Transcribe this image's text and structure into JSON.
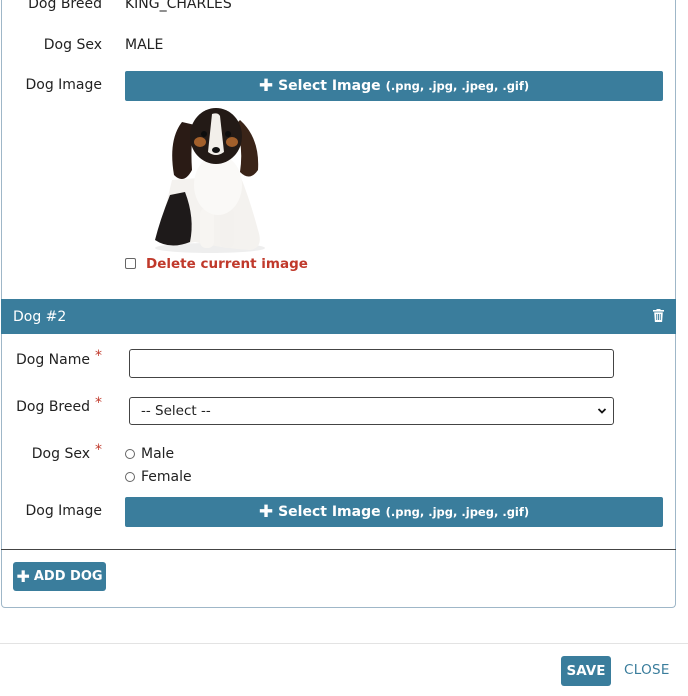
{
  "dog1": {
    "breed_label": "Dog Breed",
    "breed_value": "KING_CHARLES",
    "sex_label": "Dog Sex",
    "sex_value": "MALE",
    "image_label": "Dog Image",
    "select_image_label": "Select Image",
    "select_image_ext": "(.png, .jpg, .jpeg, .gif)",
    "delete_image_label": "Delete current image"
  },
  "dog2": {
    "header": "Dog #2",
    "name_label": "Dog Name",
    "breed_label": "Dog Breed",
    "breed_select_value": "-- Select --",
    "sex_label": "Dog Sex",
    "sex_options": [
      "Male",
      "Female"
    ],
    "image_label": "Dog Image",
    "select_image_label": "Select Image",
    "select_image_ext": "(.png, .jpg, .jpeg, .gif)",
    "required_mark": "*"
  },
  "actions": {
    "add_dog": "ADD DOG",
    "save": "SAVE",
    "close": "CLOSE"
  },
  "icons": {
    "plus": "plus-icon",
    "trash": "trash-icon",
    "caret": "chevron-down-icon"
  },
  "colors": {
    "accent": "#3a7d9c",
    "danger": "#c0392b"
  }
}
